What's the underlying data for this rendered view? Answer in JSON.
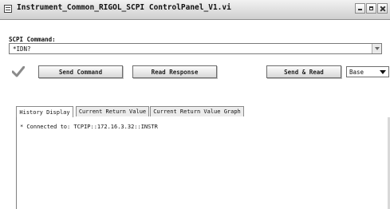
{
  "window": {
    "title": "Instrument_Common_RIGOL_SCPI ControlPanel_V1.vi"
  },
  "scpi": {
    "label": "SCPI Command:",
    "value": "*IDN?"
  },
  "buttons": {
    "send_command": "Send Command",
    "read_response": "Read Response",
    "send_and_read": "Send & Read"
  },
  "base": {
    "selected": "Base"
  },
  "tabs": [
    {
      "label": "History Display",
      "active": true
    },
    {
      "label": "Current Return Value",
      "active": false
    },
    {
      "label": "Current Return Value Graph",
      "active": false
    }
  ],
  "history": {
    "lines": [
      "* Connected to: TCPIP::172.16.3.32::INSTR"
    ]
  },
  "icons": {
    "window": "app-window-icon",
    "check": "checkmark-icon"
  }
}
